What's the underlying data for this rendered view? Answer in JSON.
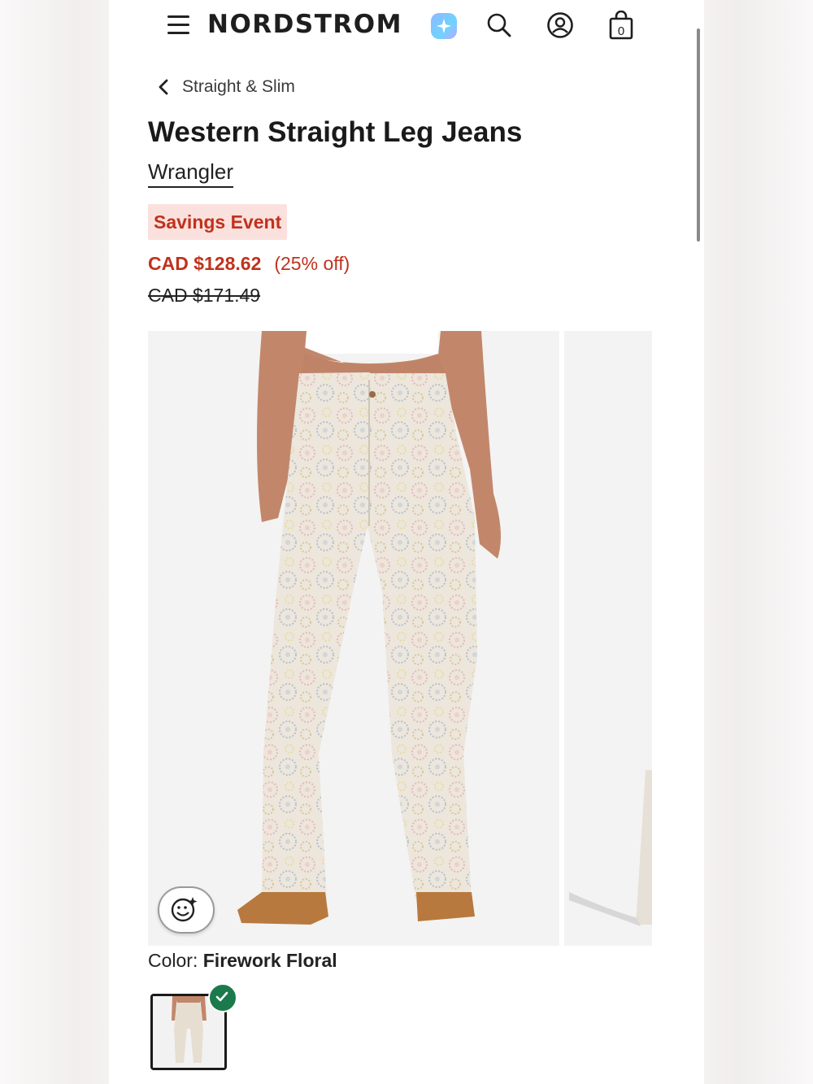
{
  "header": {
    "brand": "NORDSTROM",
    "bag_count": "0"
  },
  "breadcrumb": {
    "label": "Straight & Slim"
  },
  "product": {
    "title": "Western Straight Leg Jeans",
    "brand": "Wrangler",
    "badge": "Savings Event",
    "sale_price": "CAD $128.62",
    "discount": "(25% off)",
    "original_price": "CAD $171.49",
    "color_label": "Color:",
    "color_value": "Firework Floral"
  },
  "icons": {
    "menu": "hamburger-menu-icon",
    "ai": "sparkle-ai-icon",
    "search": "search-icon",
    "account": "account-icon",
    "bag": "shopping-bag-icon",
    "back": "chevron-left-icon",
    "tryon": "smiley-sparkle-icon",
    "selected": "checkmark-icon"
  },
  "colors": {
    "sale_red": "#c0321d",
    "badge_bg": "#fbe1dd",
    "check_green": "#1a7a4c"
  }
}
